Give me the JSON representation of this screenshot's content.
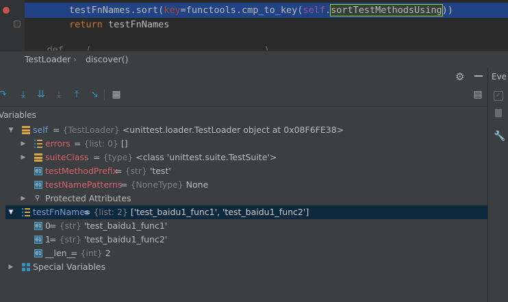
{
  "editor": {
    "line1": {
      "indent": "    ",
      "obj": "testFnNames",
      "call": ".sort(",
      "param": "key",
      "eq": "=",
      "func": "functools.cmp_to_key(",
      "self": "self",
      "dot": ".",
      "method": "sortTestMethodsUsing",
      "close": "))"
    },
    "line2": {
      "keyword": "return",
      "value": " testFnNames"
    },
    "line3": "    def ___(... ... ... ... ... ... ... ...)"
  },
  "breadcrumb": {
    "class": "TestLoader",
    "method": "discover()"
  },
  "debugger": {
    "events_tab": "Eve",
    "variables_label": "Variables",
    "rows": [
      {
        "name": "self",
        "type": "{TestLoader}",
        "value": "<unittest.loader.TestLoader object at 0x08F6FE38>"
      },
      {
        "name": "errors",
        "type": "{list: 0}",
        "value": "[]"
      },
      {
        "name": "suiteClass",
        "type": "{type}",
        "value": "<class 'unittest.suite.TestSuite'>"
      },
      {
        "name": "testMethodPrefix",
        "type": "{str}",
        "value": "'test'"
      },
      {
        "name": "testNamePatterns",
        "type": "{NoneType}",
        "value": "None"
      },
      {
        "name": "Protected Attributes"
      },
      {
        "name": "testFnNames",
        "type": "{list: 2}",
        "value": "['test_baidu1_func1', 'test_baidu1_func2']"
      },
      {
        "name": "0",
        "type": "{str}",
        "value": "'test_baidu1_func1'"
      },
      {
        "name": "1",
        "type": "{str}",
        "value": "'test_baidu1_func2'"
      },
      {
        "name": "__len__",
        "type": "{int}",
        "value": "2"
      },
      {
        "name": "Special Variables"
      }
    ],
    "sep": " = "
  },
  "colors": {
    "accent": "#3592c4",
    "selection": "#0d293e",
    "editor_highlight": "#214283"
  }
}
